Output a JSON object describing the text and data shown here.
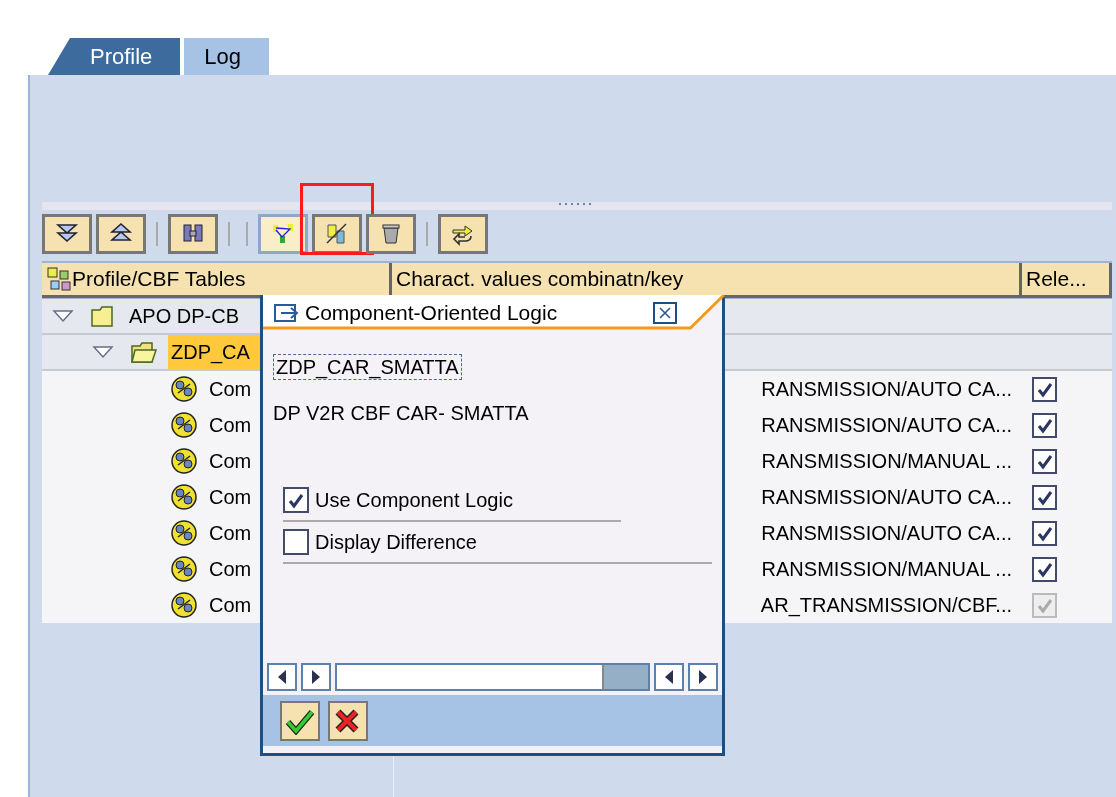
{
  "tabs": [
    {
      "label": "Profile",
      "selected": true
    },
    {
      "label": "Log",
      "selected": false
    }
  ],
  "toolbar": [
    {
      "kind": "expand-all",
      "pressed": false,
      "highlighted": false
    },
    {
      "kind": "collapse-all",
      "pressed": false,
      "highlighted": false
    },
    {
      "kind": "separator"
    },
    {
      "kind": "find",
      "pressed": false,
      "highlighted": false
    },
    {
      "kind": "separator"
    },
    {
      "kind": "separator"
    },
    {
      "kind": "hierarchy",
      "pressed": true,
      "highlighted": false
    },
    {
      "kind": "component",
      "pressed": false,
      "highlighted": true
    },
    {
      "kind": "delete",
      "pressed": false,
      "highlighted": false
    },
    {
      "kind": "separator"
    },
    {
      "kind": "switch",
      "pressed": false,
      "highlighted": false
    }
  ],
  "table": {
    "columns": [
      "Profile/CBF Tables",
      "Charact. values combinatn/key",
      "Rele..."
    ],
    "tree": [
      {
        "kind": "folder",
        "label": "APO DP-CB",
        "expanded": true,
        "selected": false,
        "children": [
          {
            "kind": "open-folder",
            "label": "ZDP_CA",
            "expanded": true,
            "selected": true,
            "children": [
              {
                "kind": "component",
                "label": "Com",
                "value": "RANSMISSION/AUTO CA...",
                "released": true,
                "disabled": false,
                "selected": false
              },
              {
                "kind": "component",
                "label": "Com",
                "value": "RANSMISSION/AUTO CA...",
                "released": true,
                "disabled": false,
                "selected": false
              },
              {
                "kind": "component",
                "label": "Com",
                "value": "RANSMISSION/MANUAL ...",
                "released": true,
                "disabled": false,
                "selected": false
              },
              {
                "kind": "component",
                "label": "Com",
                "value": "RANSMISSION/AUTO CA...",
                "released": true,
                "disabled": false,
                "selected": false
              },
              {
                "kind": "component",
                "label": "Com",
                "value": "RANSMISSION/AUTO CA...",
                "released": true,
                "disabled": false,
                "selected": false
              },
              {
                "kind": "component",
                "label": "Com",
                "value": "RANSMISSION/MANUAL ...",
                "released": true,
                "disabled": false,
                "selected": false
              },
              {
                "kind": "component",
                "label": "Com",
                "value": "AR_TRANSMISSION/CBF...",
                "released": true,
                "disabled": true,
                "selected": false
              }
            ]
          }
        ]
      }
    ]
  },
  "dialog": {
    "title": "Component-Oriented Logic",
    "name": "ZDP_CAR_SMATTA",
    "description": "DP V2R CBF CAR- SMATTA",
    "options": [
      {
        "label": "Use Component Logic",
        "checked": true
      },
      {
        "label": "Display Difference",
        "checked": false
      }
    ],
    "buttons": [
      {
        "kind": "ok"
      },
      {
        "kind": "cancel"
      }
    ]
  }
}
